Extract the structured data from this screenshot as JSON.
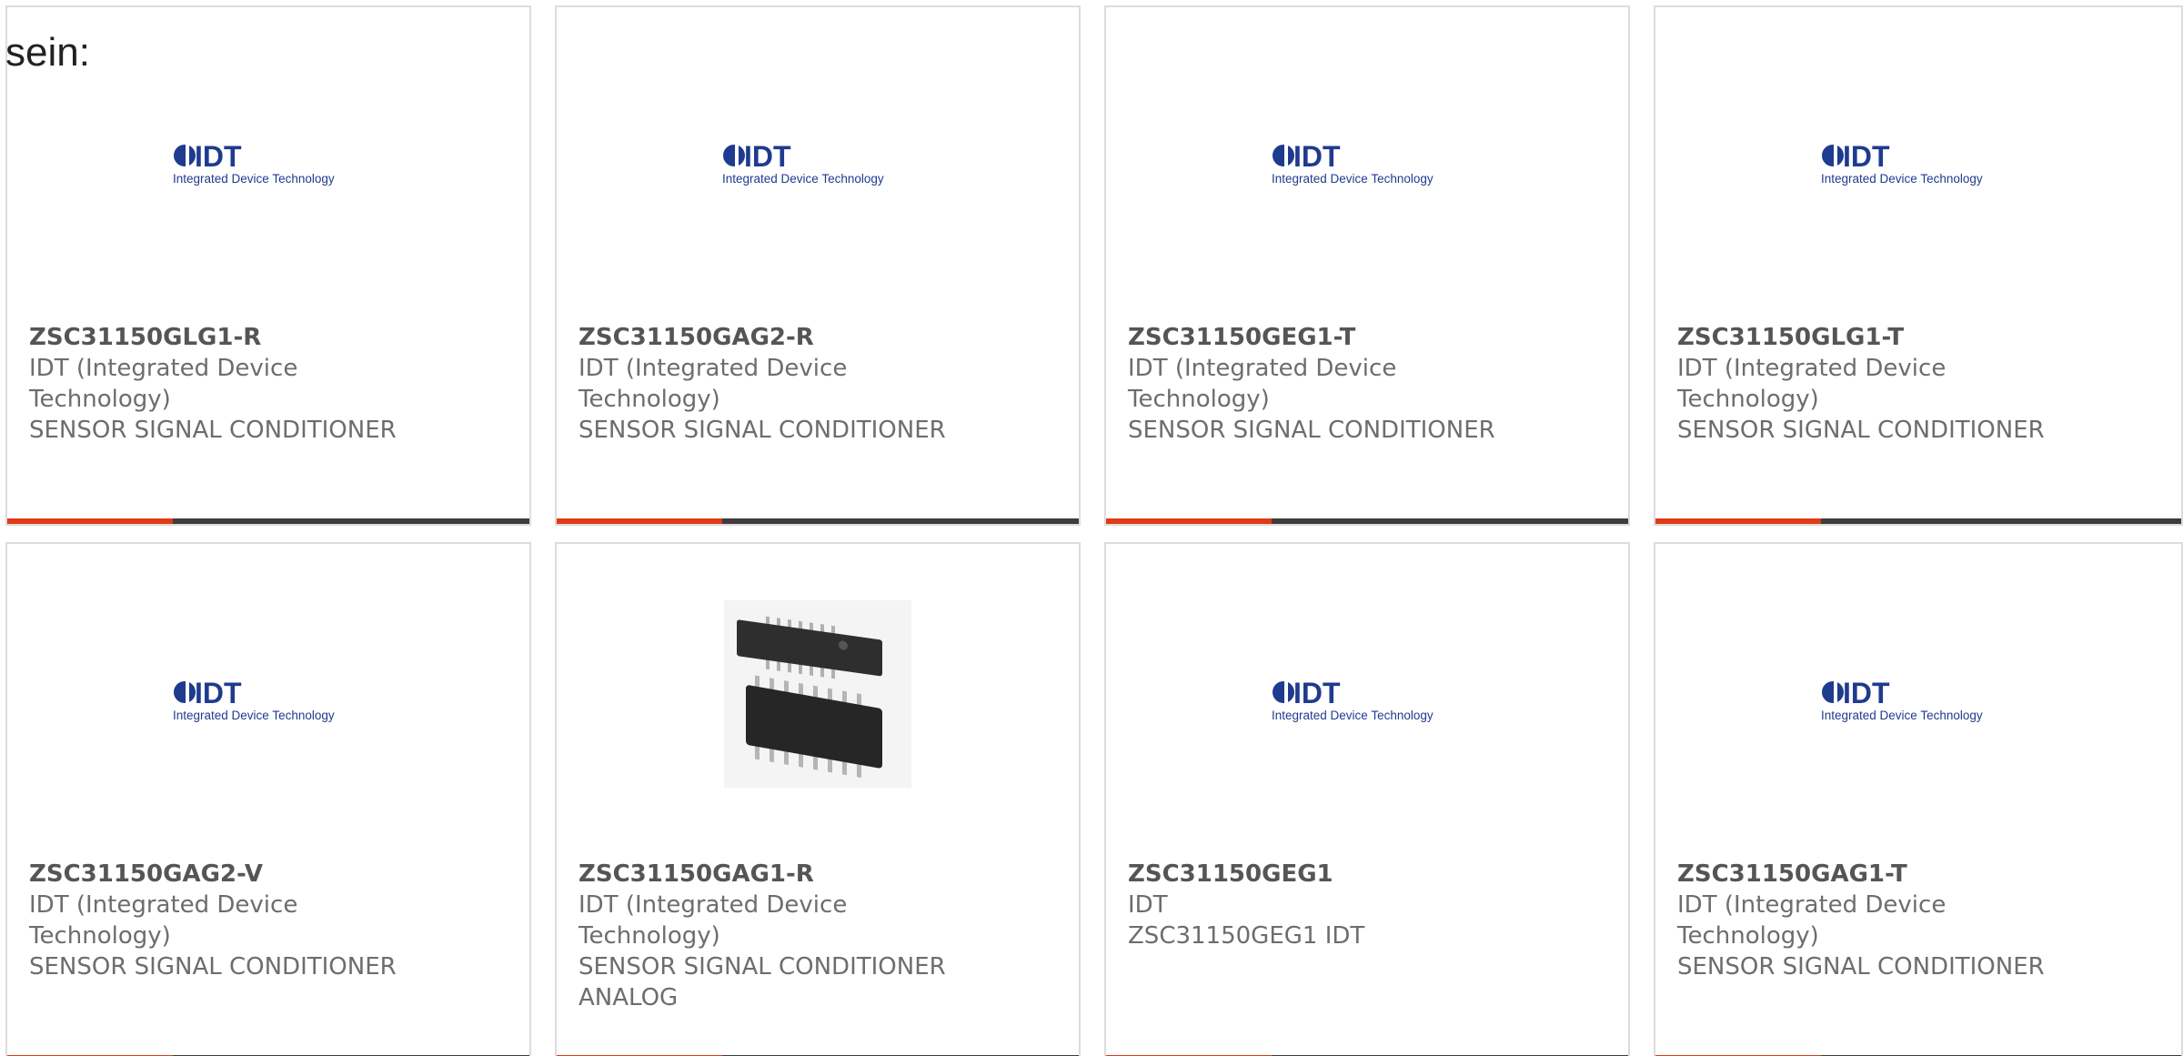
{
  "intro_text": "sein:",
  "colors": {
    "accent": "#e03a16",
    "bar": "#3d3d3d",
    "border": "#dcdcdc",
    "idt_blue": "#1f3b8f"
  },
  "logo_text": {
    "brand": "IDT",
    "tagline": "Integrated Device Technology"
  },
  "products": [
    {
      "part": "ZSC31150GLG1-R",
      "manufacturer_line1": "IDT (Integrated Device",
      "manufacturer_line2": "Technology)",
      "description_line1": "SENSOR SIGNAL CONDITIONER",
      "description_line2": "",
      "image": "idt-logo"
    },
    {
      "part": "ZSC31150GAG2-R",
      "manufacturer_line1": "IDT (Integrated Device",
      "manufacturer_line2": "Technology)",
      "description_line1": "SENSOR SIGNAL CONDITIONER",
      "description_line2": "",
      "image": "idt-logo"
    },
    {
      "part": "ZSC31150GEG1-T",
      "manufacturer_line1": "IDT (Integrated Device",
      "manufacturer_line2": "Technology)",
      "description_line1": "SENSOR SIGNAL CONDITIONER",
      "description_line2": "",
      "image": "idt-logo"
    },
    {
      "part": "ZSC31150GLG1-T",
      "manufacturer_line1": "IDT (Integrated Device",
      "manufacturer_line2": "Technology)",
      "description_line1": "SENSOR SIGNAL CONDITIONER",
      "description_line2": "",
      "image": "idt-logo"
    },
    {
      "part": "ZSC31150GAG2-V",
      "manufacturer_line1": "IDT (Integrated Device",
      "manufacturer_line2": "Technology)",
      "description_line1": "SENSOR SIGNAL CONDITIONER",
      "description_line2": "",
      "image": "idt-logo"
    },
    {
      "part": "ZSC31150GAG1-R",
      "manufacturer_line1": "IDT (Integrated Device",
      "manufacturer_line2": "Technology)",
      "description_line1": "SENSOR SIGNAL CONDITIONER",
      "description_line2": "ANALOG",
      "image": "chip-photo"
    },
    {
      "part": "ZSC31150GEG1",
      "manufacturer_line1": "IDT",
      "manufacturer_line2": "",
      "description_line1": "ZSC31150GEG1 IDT",
      "description_line2": "",
      "image": "idt-logo"
    },
    {
      "part": "ZSC31150GAG1-T",
      "manufacturer_line1": "IDT (Integrated Device",
      "manufacturer_line2": "Technology)",
      "description_line1": "SENSOR SIGNAL CONDITIONER",
      "description_line2": "",
      "image": "idt-logo"
    }
  ]
}
